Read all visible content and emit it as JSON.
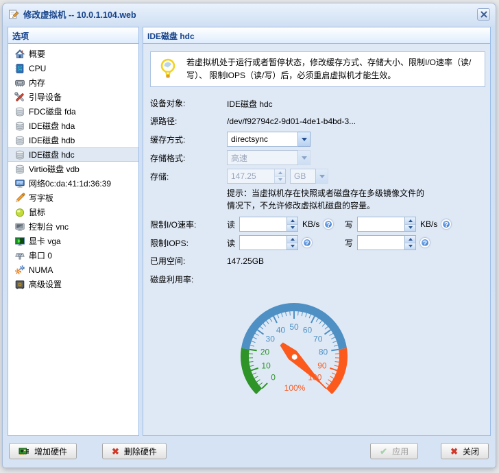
{
  "window": {
    "title": "修改虚拟机 -- 10.0.1.104.web"
  },
  "sidebar": {
    "header": "选项",
    "items": [
      {
        "label": "概要",
        "icon": "home-icon",
        "selected": false
      },
      {
        "label": "CPU",
        "icon": "cpu-icon",
        "selected": false
      },
      {
        "label": "内存",
        "icon": "memory-icon",
        "selected": false
      },
      {
        "label": "引导设备",
        "icon": "boot-device-icon",
        "selected": false
      },
      {
        "label": "FDC磁盘 fda",
        "icon": "disk-icon",
        "selected": false
      },
      {
        "label": "IDE磁盘 hda",
        "icon": "disk-icon",
        "selected": false
      },
      {
        "label": "IDE磁盘 hdb",
        "icon": "disk-icon",
        "selected": false
      },
      {
        "label": "IDE磁盘 hdc",
        "icon": "disk-icon",
        "selected": true
      },
      {
        "label": "Virtio磁盘 vdb",
        "icon": "disk-icon",
        "selected": false
      },
      {
        "label": "网络0c:da:41:1d:36:39",
        "icon": "network-icon",
        "selected": false
      },
      {
        "label": "写字板",
        "icon": "tablet-pen-icon",
        "selected": false
      },
      {
        "label": "鼠标",
        "icon": "mouse-icon",
        "selected": false
      },
      {
        "label": "控制台 vnc",
        "icon": "console-icon",
        "selected": false
      },
      {
        "label": "显卡 vga",
        "icon": "display-icon",
        "selected": false
      },
      {
        "label": "串口 0",
        "icon": "serial-port-icon",
        "selected": false
      },
      {
        "label": "NUMA",
        "icon": "numa-gears-icon",
        "selected": false
      },
      {
        "label": "高级设置",
        "icon": "advanced-settings-icon",
        "selected": false
      }
    ]
  },
  "main": {
    "header": "IDE磁盘 hdc",
    "notice": "若虚拟机处于运行或者暂停状态，修改缓存方式、存储大小、限制I/O速率（读/写）、 限制IOPS（读/写）后，必须重启虚拟机才能生效。",
    "fields": {
      "device_label": "设备对象:",
      "device_value": "IDE磁盘 hdc",
      "source_label": "源路径:",
      "source_value": "/dev/f92794c2-9d01-4de1-b4bd-3...",
      "cache_label": "缓存方式:",
      "cache_value": "directsync",
      "format_label": "存储格式:",
      "format_value": "高速",
      "storage_label": "存储:",
      "storage_value": "147.25",
      "storage_unit": "GB",
      "storage_tip": "提示：当虚拟机存在快照或者磁盘存在多级镜像文件的情况下，不允许修改虚拟机磁盘的容量。",
      "io_label": "限制I/O速率:",
      "iops_label": "限制IOPS:",
      "read_label": "读",
      "write_label": "写",
      "unit_kbs": "KB/s",
      "used_label": "已用空间:",
      "used_value": "147.25GB",
      "util_label": "磁盘利用率:"
    }
  },
  "footer": {
    "add_hw": "增加硬件",
    "del_hw": "删除硬件",
    "apply": "应用",
    "close": "关闭"
  },
  "chart_data": {
    "type": "gauge",
    "title": "磁盘利用率",
    "min": 0,
    "max": 100,
    "value": 100,
    "value_label": "100%",
    "start_angle_deg": 225,
    "sweep_deg": 270,
    "major_tick_interval": 10,
    "minor_tick_interval": 2,
    "tick_labels": [
      0,
      10,
      20,
      30,
      40,
      50,
      60,
      70,
      80,
      90,
      100
    ],
    "zones": [
      {
        "from": 0,
        "to": 20,
        "color": "#2e9428"
      },
      {
        "from": 20,
        "to": 80,
        "color": "#4e90c4"
      },
      {
        "from": 80,
        "to": 100,
        "color": "#fc5a1d"
      }
    ],
    "needle_color": "#fc5a1d",
    "legend": "none",
    "grid": "off"
  }
}
